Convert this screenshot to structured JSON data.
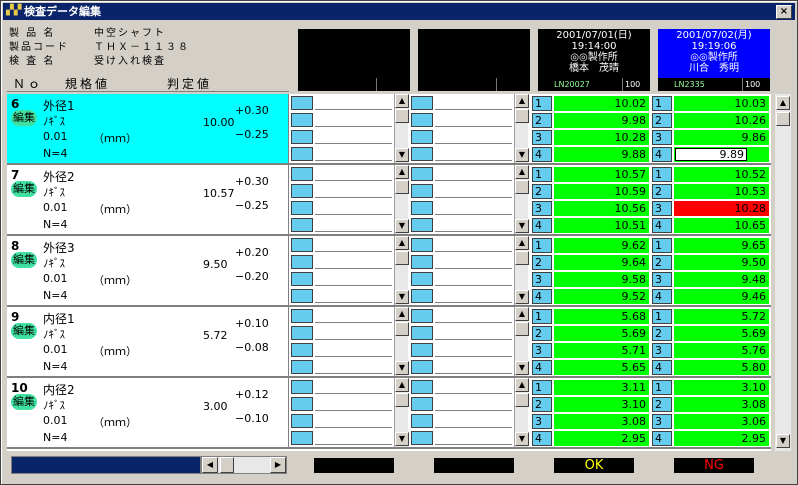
{
  "window": {
    "title": "検査データ編集",
    "close_label": "×"
  },
  "header": {
    "rows": [
      {
        "key": "製 品 名",
        "value": "中空シャフト"
      },
      {
        "key": "製品コード",
        "value": "ＴＨＸ－１１３８"
      },
      {
        "key": "検 査 名",
        "value": "受け入れ検査"
      }
    ],
    "col_no": "Ｎｏ",
    "col_spec": "規格値",
    "col_judge": "判定値"
  },
  "machines": [
    {
      "date": "2001/07/01(日)",
      "time": "19:14:00",
      "company": "◎◎製作所",
      "person": "橋本　茂晴",
      "lot": "LN20027",
      "count": "100",
      "active": false
    },
    {
      "date": "2001/07/02(月)",
      "time": "19:19:06",
      "company": "◎◎製作所",
      "person": "川合　秀明",
      "lot": "LN2335",
      "count": "100",
      "active": true
    }
  ],
  "rows": [
    {
      "no": "6",
      "edit": "編集",
      "name": "外径1",
      "tool": "ﾉｷﾞｽ",
      "unit_val": "0.01",
      "unit": "（ｍｍ）",
      "n": "N=4",
      "nominal": "10.00",
      "upper": "+0.30",
      "lower": "−0.25",
      "selected": true,
      "m1": [
        "10.02",
        "9.98",
        "10.28",
        "9.88"
      ],
      "m2": [
        "10.03",
        "10.26",
        "9.86",
        "9.89"
      ],
      "m2_status": [
        "ok",
        "ok",
        "ok",
        "edit"
      ]
    },
    {
      "no": "7",
      "edit": "編集",
      "name": "外径2",
      "tool": "ﾉｷﾞｽ",
      "unit_val": "0.01",
      "unit": "（ｍｍ）",
      "n": "N=4",
      "nominal": "10.57",
      "upper": "+0.30",
      "lower": "−0.25",
      "selected": false,
      "m1": [
        "10.57",
        "10.59",
        "10.56",
        "10.51"
      ],
      "m2": [
        "10.52",
        "10.53",
        "10.28",
        "10.65"
      ],
      "m2_status": [
        "ok",
        "ok",
        "ng",
        "ok"
      ]
    },
    {
      "no": "8",
      "edit": "編集",
      "name": "外径3",
      "tool": "ﾉｷﾞｽ",
      "unit_val": "0.01",
      "unit": "（ｍｍ）",
      "n": "N=4",
      "nominal": "9.50",
      "upper": "+0.20",
      "lower": "−0.20",
      "selected": false,
      "m1": [
        "9.62",
        "9.64",
        "9.58",
        "9.52"
      ],
      "m2": [
        "9.65",
        "9.50",
        "9.48",
        "9.46"
      ],
      "m2_status": [
        "ok",
        "ok",
        "ok",
        "ok"
      ]
    },
    {
      "no": "9",
      "edit": "編集",
      "name": "内径1",
      "tool": "ﾉｷﾞｽ",
      "unit_val": "0.01",
      "unit": "（ｍｍ）",
      "n": "N=4",
      "nominal": "5.72",
      "upper": "+0.10",
      "lower": "−0.08",
      "selected": false,
      "m1": [
        "5.68",
        "5.69",
        "5.71",
        "5.65"
      ],
      "m2": [
        "5.72",
        "5.69",
        "5.76",
        "5.80"
      ],
      "m2_status": [
        "ok",
        "ok",
        "ok",
        "ok"
      ]
    },
    {
      "no": "10",
      "edit": "編集",
      "name": "内径2",
      "tool": "ﾉｷﾞｽ",
      "unit_val": "0.01",
      "unit": "（ｍｍ）",
      "n": "N=4",
      "nominal": "3.00",
      "upper": "+0.12",
      "lower": "−0.10",
      "selected": false,
      "m1": [
        "3.11",
        "3.10",
        "3.08",
        "2.95"
      ],
      "m2": [
        "3.10",
        "3.08",
        "3.06",
        "2.95"
      ],
      "m2_status": [
        "ok",
        "ok",
        "ok",
        "ok"
      ]
    }
  ],
  "meas_nums": [
    "1",
    "2",
    "3",
    "4"
  ],
  "footer": {
    "ok_label": "OK",
    "ng_label": "NG",
    "ok_color": "#ffff00",
    "ng_color": "#ff0000"
  }
}
